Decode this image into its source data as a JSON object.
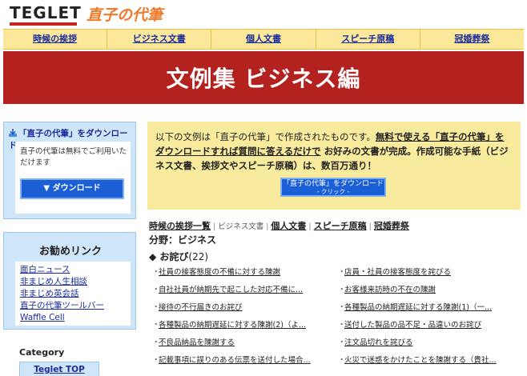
{
  "header": {
    "logo_text": "TEGLET",
    "site_title": "直子の代筆"
  },
  "nav": {
    "items": [
      {
        "label": "時候の挨拶"
      },
      {
        "label": "ビジネス文書"
      },
      {
        "label": "個人文書"
      },
      {
        "label": "スピーチ原稿"
      },
      {
        "label": "冠婚葬祭"
      }
    ]
  },
  "banner": {
    "title": "文例集 ビジネス編"
  },
  "sidebar": {
    "download_box": {
      "title": "「直子の代筆」をダウンロード",
      "text": "直子の代筆は無料でご利用いただけます",
      "button_label": "▼ ダウンロード"
    },
    "recommend": {
      "title": "お勧めリンク",
      "links": [
        "面白ニュース",
        "非まじめ人生相談",
        "非まじめ英会話",
        "直子の代筆ツールバー",
        "Waffle Cell"
      ]
    },
    "category": {
      "label": "Category",
      "button": "Teglet TOP"
    }
  },
  "notice": {
    "part1": "以下の文例は「直子の代筆」で作成されたものです。",
    "part2": "無料で使える「直子の代筆」をダウンロードすれば質問に答えるだけで",
    "part3": " お好みの文書が完成。作成可能な手紙（ビジネス文書、挨拶文やスピーチ原稿）は、数百万通り！",
    "button_line1": "「直子の代筆」をダウンロード",
    "button_line2": "- クリック -"
  },
  "breadcrumbs": {
    "items": [
      {
        "label": "時候の挨拶一覧",
        "current": false
      },
      {
        "label": "ビジネス文書",
        "current": true
      },
      {
        "label": "個人文書",
        "current": false
      },
      {
        "label": "スピーチ原稿",
        "current": false
      },
      {
        "label": "冠婚葬祭",
        "current": false
      }
    ],
    "separator": "|"
  },
  "section": {
    "label": "分野：ビジネス",
    "subsection_title": "◆ お詫び",
    "subsection_count": "(22)"
  },
  "list": {
    "left": [
      "社員の接客態度の不備に対する陳謝",
      "自社社員が納期先で起こした対応不備に...",
      "接待の不行届きのお詫び",
      "各種製品の納期遅延に対する陳謝(2)（よ...",
      "不良品納品を陳謝する",
      "記載事項に誤りのある伝票を送付した場合..."
    ],
    "right": [
      "店員・社員の接客態度を詫びる",
      "お客様来訪時の不在の陳謝",
      "各種製品の納期遅延に対する陳謝(1)（一...",
      "送付した製品の品不足・品違いのお詫び",
      "注文品切れを詫びる",
      "火災で迷惑をかけたことを陳謝する（貴社..."
    ]
  },
  "colors": {
    "banner": "#b3221e",
    "nav_bg": "#fbe89b",
    "sidebar_bg": "#cfe6f8",
    "notice_bg": "#f8eb9d",
    "button_blue": "#1b5fd6",
    "logo_accent": "#f07a2a"
  }
}
